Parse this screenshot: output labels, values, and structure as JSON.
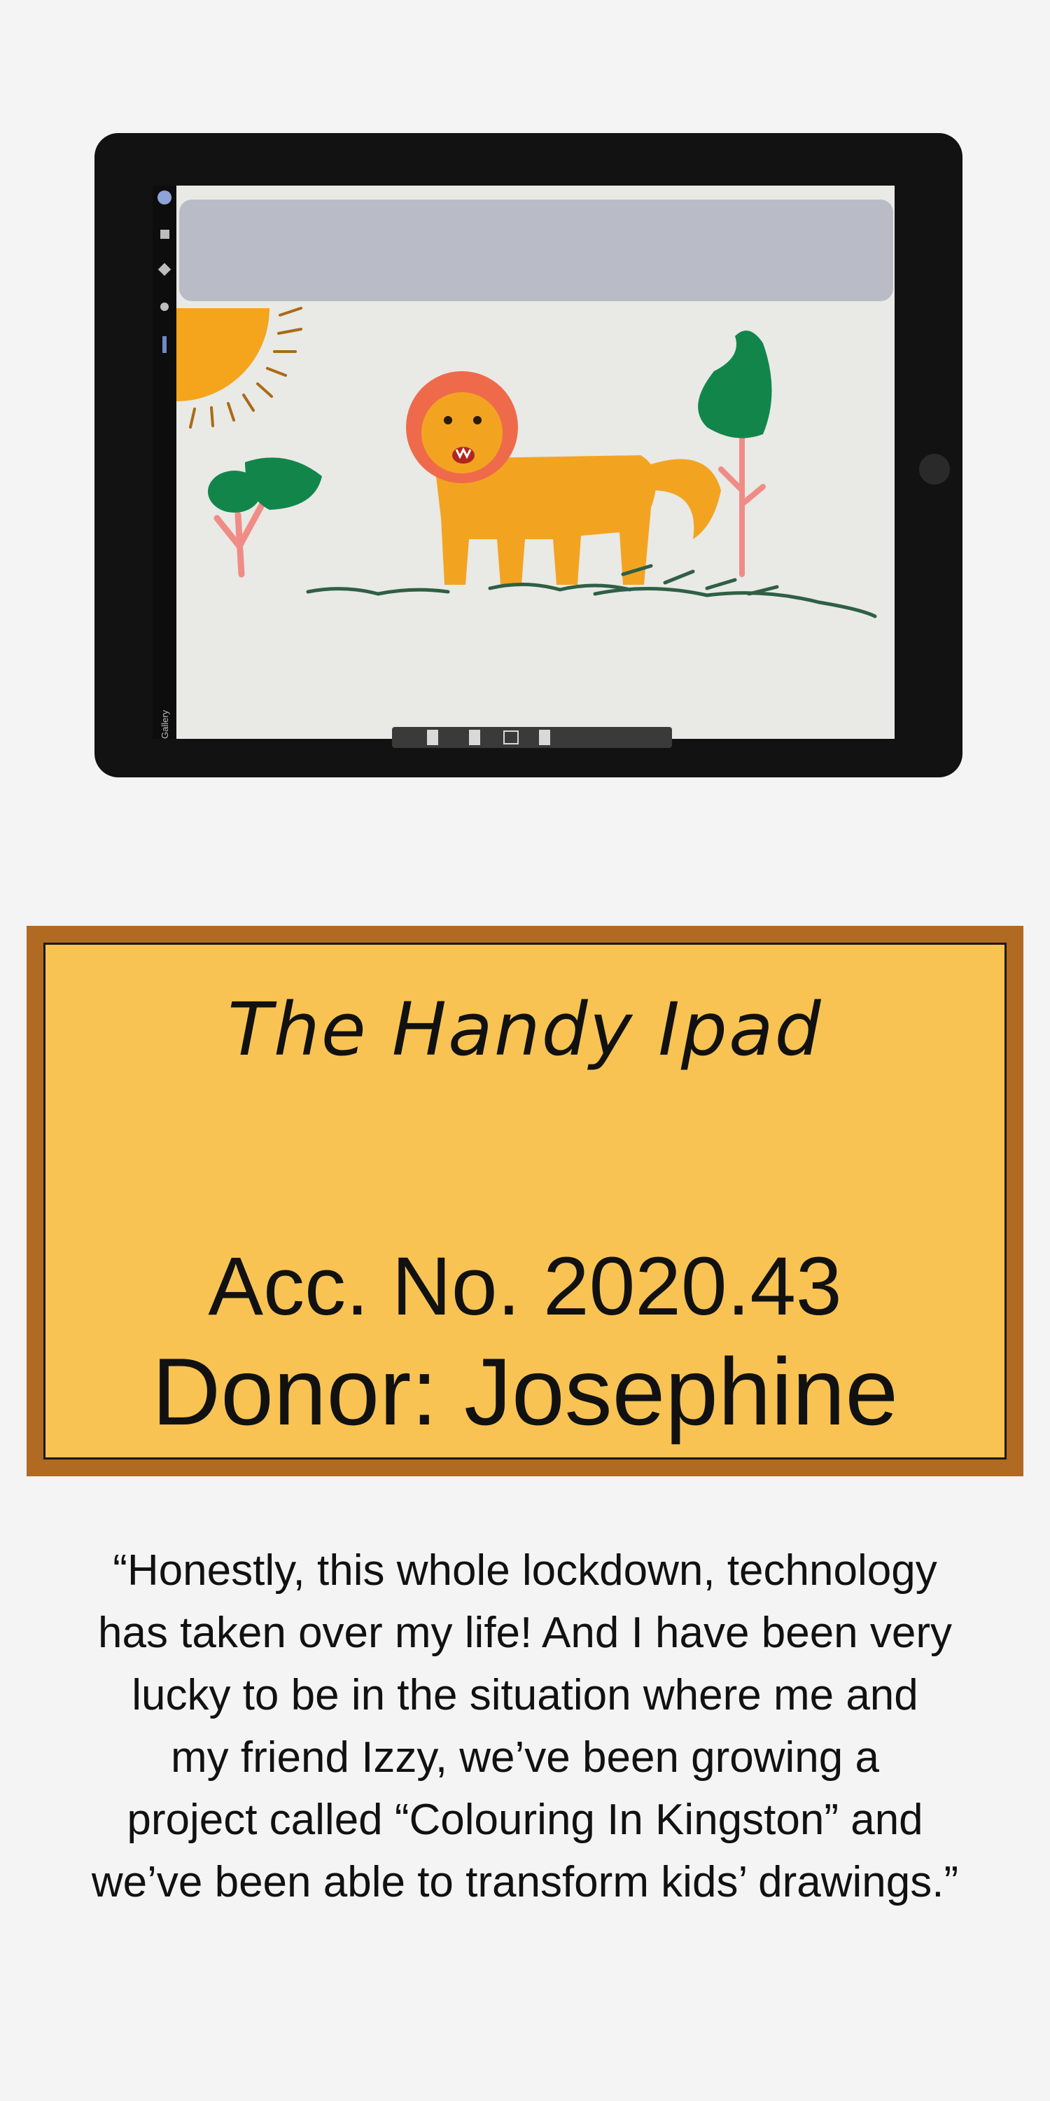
{
  "label": {
    "title": "The Handy Ipad",
    "accession": "Acc. No. 2020.43",
    "donor": "Donor: Josephine"
  },
  "quote": {
    "text": "“Honestly, this whole lockdown, technology\nhas taken over my life! And I have been very\nlucky to be in the situation where me and\nmy friend Izzy, we’ve been growing a\nproject called “Colouring In Kingston” and\nwe’ve been able to transform kids’ drawings.”"
  },
  "illustration": {
    "sidebar_label": "Gallery",
    "colors": {
      "frame": "#121212",
      "screen": "#e9e9e6",
      "sky_band": "#b9bcc7",
      "sun": "#f4a51c",
      "lion_body": "#f2a421",
      "mane": "#ef6a4a",
      "tree_top": "#12864a",
      "trunk": "#f08c86",
      "grass": "#2f5f44",
      "label_bg": "#f8c353",
      "label_border": "#b06a22"
    }
  }
}
